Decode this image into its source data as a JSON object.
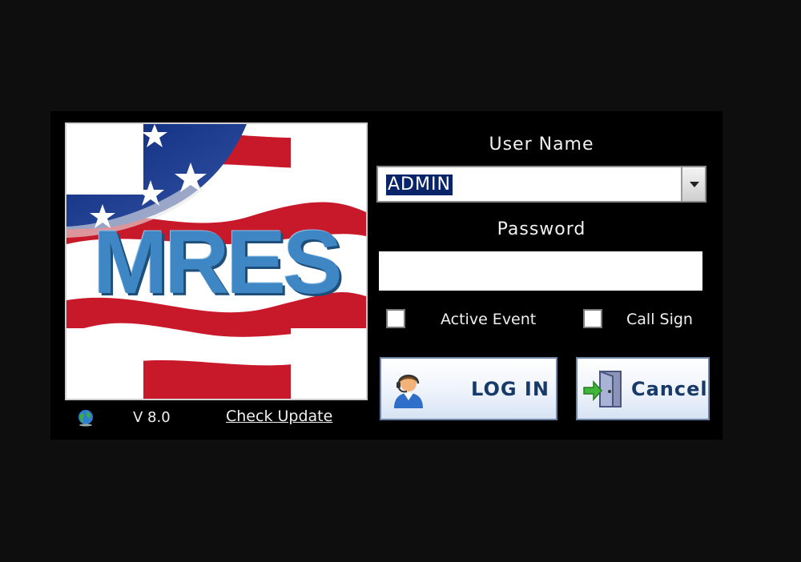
{
  "login": {
    "username_label": "User Name",
    "username_value": "ADMIN",
    "password_label": "Password",
    "password_value": "",
    "active_event_label": "Active Event",
    "call_sign_label": "Call Sign",
    "login_button": "LOG IN",
    "cancel_button": "Cancel"
  },
  "footer": {
    "version": "V 8.0",
    "check_update": "Check Update"
  },
  "logo": {
    "text": "MRES"
  },
  "icons": {
    "globe": "globe-icon",
    "user": "user-headset-icon",
    "exit": "exit-door-icon"
  },
  "colors": {
    "background": "#0e0e0e",
    "panel": "#000000",
    "logo_blue": "#3e86c4",
    "selection": "#0a246a",
    "button_text": "#173a6a"
  }
}
